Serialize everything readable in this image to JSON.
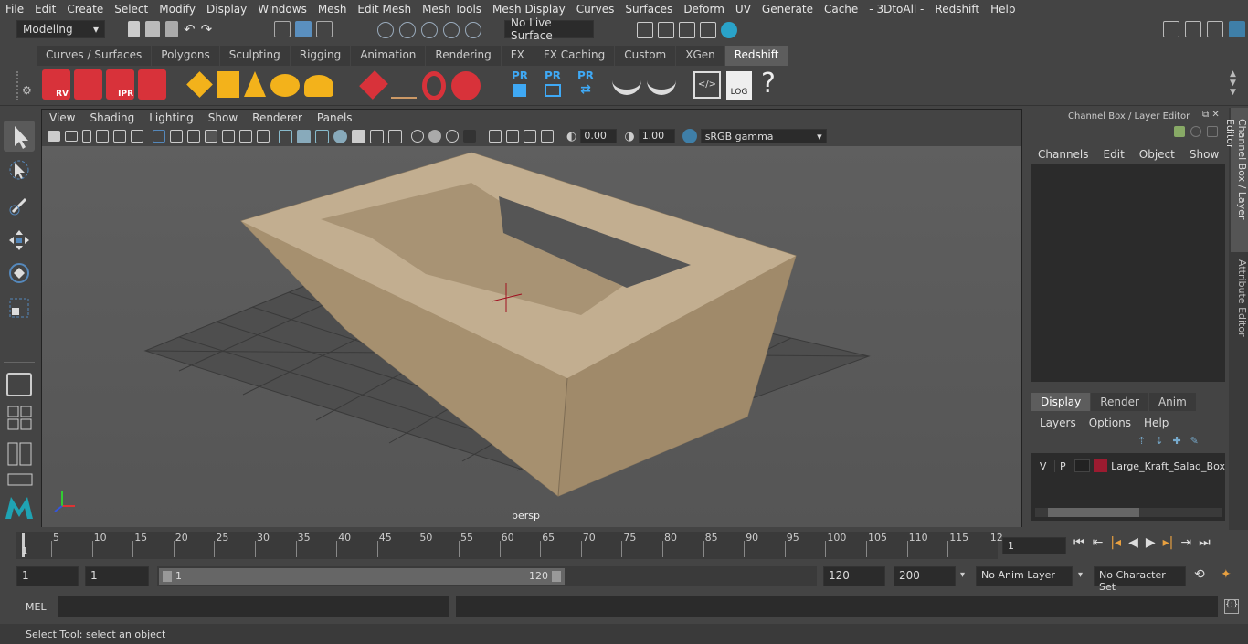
{
  "menubar": [
    "File",
    "Edit",
    "Create",
    "Select",
    "Modify",
    "Display",
    "Windows",
    "Mesh",
    "Edit Mesh",
    "Mesh Tools",
    "Mesh Display",
    "Curves",
    "Surfaces",
    "Deform",
    "UV",
    "Generate",
    "Cache",
    "- 3DtoAll -",
    "Redshift",
    "Help"
  ],
  "status": {
    "mode": "Modeling",
    "live_surface": "No Live Surface"
  },
  "shelf_tabs": [
    "Curves / Surfaces",
    "Polygons",
    "Sculpting",
    "Rigging",
    "Animation",
    "Rendering",
    "FX",
    "FX Caching",
    "Custom",
    "XGen",
    "Redshift"
  ],
  "shelf_active": "Redshift",
  "shelf_icons": [
    "RV",
    "",
    "IPR",
    "",
    "",
    "",
    "",
    "",
    "",
    "",
    "",
    "",
    "PR",
    "PR",
    "PR",
    "",
    "",
    "",
    "LOG",
    "?"
  ],
  "viewport": {
    "menu": [
      "View",
      "Shading",
      "Lighting",
      "Show",
      "Renderer",
      "Panels"
    ],
    "exposure": "0.00",
    "gamma": "1.00",
    "colorspace": "sRGB gamma",
    "camera": "persp"
  },
  "channel_box": {
    "title": "Channel Box / Layer Editor",
    "menu": [
      "Channels",
      "Edit",
      "Object",
      "Show"
    ]
  },
  "layer_editor": {
    "tabs": [
      "Display",
      "Render",
      "Anim"
    ],
    "menu": [
      "Layers",
      "Options",
      "Help"
    ],
    "layer": {
      "v": "V",
      "p": "P",
      "name": "Large_Kraft_Salad_Box",
      "color": "#9b1b30"
    }
  },
  "side_tabs": [
    "Channel Box / Layer Editor",
    "Attribute Editor"
  ],
  "timeline": {
    "ticks": [
      "5",
      "10",
      "15",
      "20",
      "25",
      "30",
      "35",
      "40",
      "45",
      "50",
      "55",
      "60",
      "65",
      "70",
      "75",
      "80",
      "85",
      "90",
      "95",
      "100",
      "105",
      "110",
      "115",
      "12"
    ],
    "start": "1",
    "current": "1"
  },
  "range": {
    "start": "1",
    "anim_start": "1",
    "slider_start": "1",
    "slider_end": "120",
    "end": "120",
    "anim_end": "200",
    "anim_layer": "No Anim Layer",
    "char_set": "No Character Set"
  },
  "mel": {
    "label": "MEL"
  },
  "help": "Select Tool: select an object"
}
